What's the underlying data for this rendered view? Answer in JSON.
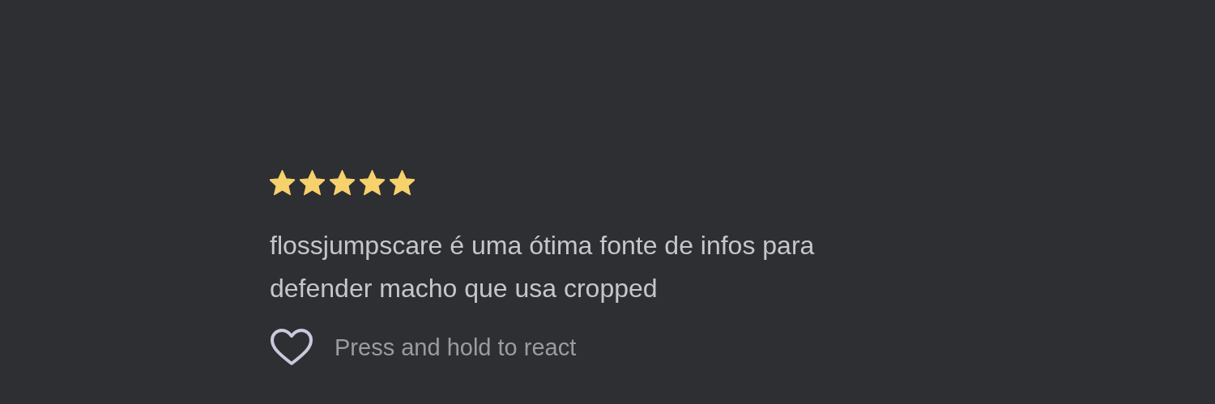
{
  "review": {
    "stars": 5,
    "text": "flossjumpscare é uma ótima fonte de infos para defender macho que usa cropped",
    "liked": false,
    "react_hint": "Press and hold to react"
  }
}
